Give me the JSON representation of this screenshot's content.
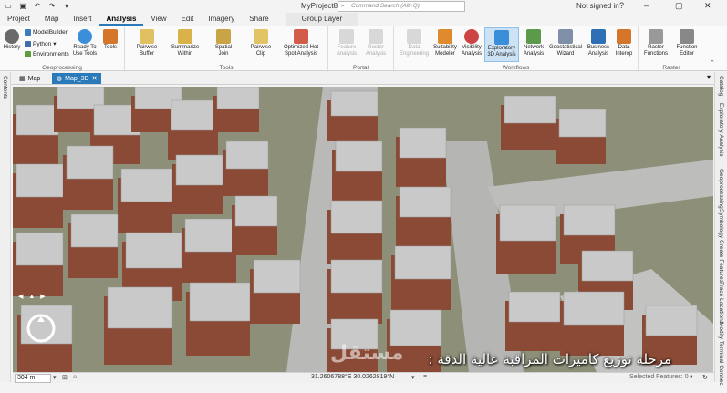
{
  "titlebar": {
    "title": "MyProject8",
    "search_placeholder": "Command Search (Alt+Q)",
    "signin": "Not signed in",
    "qat_icons": [
      "folder-open-icon",
      "save-icon",
      "undo-icon",
      "redo-icon",
      "dropdown-icon"
    ]
  },
  "ribbon_tabs": [
    "Project",
    "Map",
    "Insert",
    "Analysis",
    "View",
    "Edit",
    "Imagery",
    "Share",
    "Group Layer"
  ],
  "active_tab": "Analysis",
  "ribbon": {
    "geoprocessing": {
      "label": "Geoprocessing",
      "history": "History",
      "modelbuilder": "ModelBuilder",
      "python": "Python",
      "environments": "Environments",
      "ready_line1": "Ready To",
      "ready_line2": "Use Tools",
      "tools": "Tools"
    },
    "tools": {
      "label": "Tools",
      "buttons": [
        {
          "l1": "Pairwise",
          "l2": "Buffer"
        },
        {
          "l1": "Summarize",
          "l2": "Within"
        },
        {
          "l1": "Spatial",
          "l2": "Join"
        },
        {
          "l1": "Pairwise",
          "l2": "Clip"
        },
        {
          "l1": "Optimized Hot",
          "l2": "Spot Analysis"
        }
      ]
    },
    "portal": {
      "label": "Portal",
      "buttons": [
        {
          "l1": "Feature",
          "l2": "Analysis"
        },
        {
          "l1": "Raster",
          "l2": "Analysis"
        }
      ]
    },
    "workflows": {
      "label": "Workflows",
      "buttons": [
        {
          "l1": "Data",
          "l2": "Engineering"
        },
        {
          "l1": "Suitability",
          "l2": "Modeler"
        },
        {
          "l1": "Visibility",
          "l2": "Analysis"
        },
        {
          "l1": "Exploratory",
          "l2": "3D Analysis"
        },
        {
          "l1": "Network",
          "l2": "Analysis"
        },
        {
          "l1": "Geostatistical",
          "l2": "Wizard"
        },
        {
          "l1": "Business",
          "l2": "Analysis"
        },
        {
          "l1": "Data",
          "l2": "Interop"
        }
      ]
    },
    "raster": {
      "label": "Raster",
      "buttons": [
        {
          "l1": "Raster",
          "l2": "Functions"
        },
        {
          "l1": "Function",
          "l2": "Editor"
        }
      ]
    }
  },
  "left_panel": {
    "contents": "Contents"
  },
  "right_panel": [
    "Catalog",
    "Exploratory Analysis",
    "Geoprocessing",
    "Symbology",
    "Create Features",
    "Trace Locations",
    "Modify Terminal Connec"
  ],
  "view_tabs": [
    {
      "label": "Map",
      "active": false
    },
    {
      "label": "Map_3D",
      "active": true
    }
  ],
  "overlay": {
    "caption": "مرحلة توزيع كاميرات المراقبة عالية الدقة :",
    "watermark": "مستقل"
  },
  "status": {
    "scale": "304 m",
    "coords": "31.2606788°E 30.0262819°N",
    "selected": "Selected Features: 0"
  },
  "colors": {
    "accent": "#2a7ab9",
    "ground": "#8d8f78",
    "road": "#bcbcbc",
    "roof": "#c9c9c9",
    "wall": "#8a4a35"
  }
}
